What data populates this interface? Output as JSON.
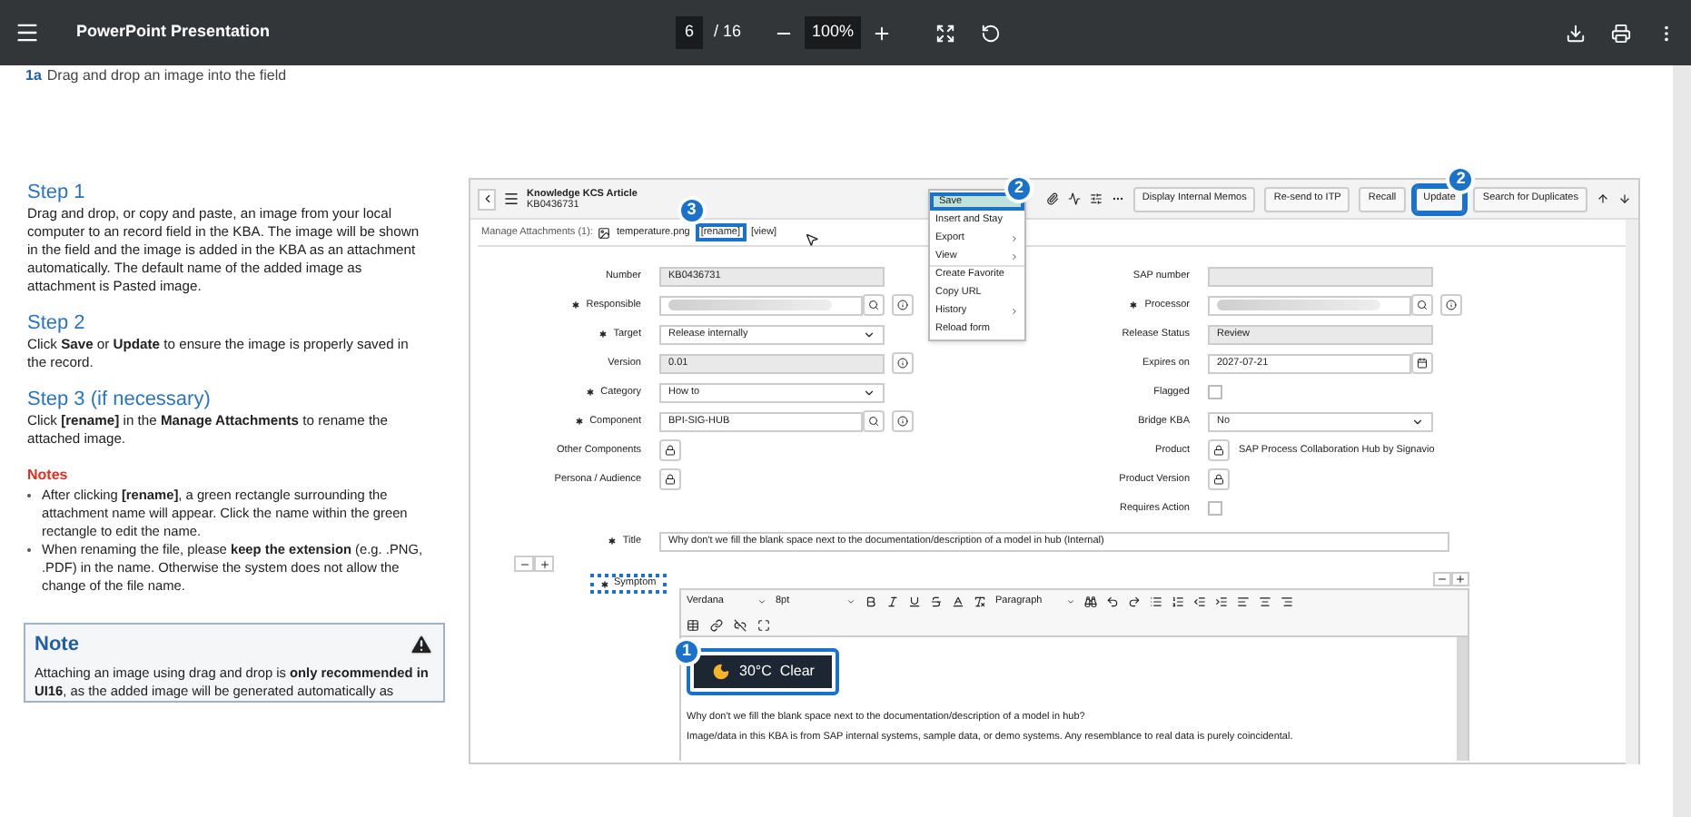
{
  "viewer": {
    "title": "PowerPoint Presentation",
    "page": "6",
    "page_count": "/ 16",
    "zoom": "100%"
  },
  "heading": {
    "number": "1a",
    "text": "Drag and drop an image into the field"
  },
  "steps": [
    {
      "title": "Step 1",
      "text": "Drag and drop, or copy and paste, an image from your local computer to an record field in the KBA. The image will be shown in the field and the image is added in the KBA as an attachment automatically. The default name of the added image as attachment is Pasted image."
    },
    {
      "title": "Step 2",
      "text": "Click **Save** or **Update** to ensure the image is properly saved in the record."
    },
    {
      "title": "Step 3 (if necessary)",
      "text": "Click **[rename]** in the **Manage Attachments** to rename the attached image."
    }
  ],
  "notes": {
    "title": "Notes",
    "items": [
      "After clicking **[rename]**, a green rectangle surrounding the attachment name will appear. Click the name within the green rectangle to edit the name.",
      "When renaming the file, please **keep the extension** (e.g. .PNG, .PDF) in the name. Otherwise the system does not allow the change of the file name."
    ]
  },
  "note_box": {
    "title": "Note",
    "text": "Attaching an image using drag and drop is **only recommended in UI16**, as the added image will be generated automatically as"
  },
  "record": {
    "title": "Knowledge KCS Article",
    "number": "KB0436731",
    "buttons": [
      {
        "label": "Display Internal Memos",
        "highlighted": false
      },
      {
        "label": "Re-send to ITP",
        "highlighted": false
      },
      {
        "label": "Recall",
        "highlighted": false
      },
      {
        "label": "Update",
        "highlighted": true,
        "callout": "2"
      },
      {
        "label": "Search for Duplicates",
        "highlighted": false
      }
    ],
    "menu": {
      "callout": "2",
      "items": [
        {
          "label": "Save",
          "submenu": false,
          "highlighted": true
        },
        {
          "label": "Insert and Stay",
          "submenu": false,
          "highlighted": false
        },
        {
          "label": "Export",
          "submenu": true,
          "highlighted": false
        },
        {
          "label": "View",
          "submenu": true,
          "highlighted": false
        },
        {
          "label": "Create Favorite",
          "submenu": false,
          "highlighted": false
        },
        {
          "label": "Copy URL",
          "submenu": false,
          "highlighted": false
        },
        {
          "label": "History",
          "submenu": true,
          "highlighted": false
        },
        {
          "label": "Reload form",
          "submenu": false,
          "highlighted": false
        }
      ]
    },
    "attachments": {
      "label": "Manage Attachments (1):",
      "file": "temperature.png",
      "rename": "[rename]",
      "rename_callout": "3",
      "view": "[view]"
    },
    "left_fields": [
      {
        "label": "Number",
        "required": false,
        "kind": "readonly",
        "value": "KB0436731",
        "info": false
      },
      {
        "label": "Responsible",
        "required": true,
        "kind": "lookup",
        "redacted": true,
        "info": true
      },
      {
        "label": "Target",
        "required": true,
        "kind": "select",
        "value": "Release internally",
        "info": false
      },
      {
        "label": "Version",
        "required": false,
        "kind": "readonly",
        "value": "0.01",
        "info": true
      },
      {
        "label": "Category",
        "required": true,
        "kind": "select",
        "value": "How to",
        "info": false
      },
      {
        "label": "Component",
        "required": true,
        "kind": "lookup",
        "value": "BPI-SIG-HUB",
        "info": true
      },
      {
        "label": "Other Components",
        "required": false,
        "kind": "lock",
        "info": false
      },
      {
        "label": "Persona / Audience",
        "required": false,
        "kind": "lock",
        "info": false
      }
    ],
    "right_fields": [
      {
        "label": "SAP number",
        "required": false,
        "kind": "readonly",
        "info": false
      },
      {
        "label": "Processor",
        "required": true,
        "kind": "lookup",
        "redacted": true,
        "info": true
      },
      {
        "label": "Release Status",
        "required": false,
        "kind": "readonly",
        "value": "Review",
        "info": false
      },
      {
        "label": "Expires on",
        "required": false,
        "kind": "date",
        "value": "2027-07-21",
        "info": false
      },
      {
        "label": "Flagged",
        "required": false,
        "kind": "checkbox",
        "checked": false,
        "info": false
      },
      {
        "label": "Bridge KBA",
        "required": false,
        "kind": "select",
        "value": "No",
        "info": false
      },
      {
        "label": "Product",
        "required": false,
        "kind": "lock",
        "value": "SAP Process Collaboration Hub by Signavio",
        "info": false
      },
      {
        "label": "Product Version",
        "required": false,
        "kind": "lock",
        "info": false
      },
      {
        "label": "Requires Action",
        "required": false,
        "kind": "checkbox",
        "checked": false,
        "info": false
      }
    ],
    "title_field": {
      "label": "Title",
      "required": true,
      "value": "Why don't we fill the blank space next to the documentation/description of a model in hub (Internal)"
    },
    "symptom": {
      "label": "Symptom",
      "required": true,
      "highlighted": true
    },
    "editor": {
      "font": "Verdana",
      "size": "8pt",
      "block": "Paragraph",
      "widget": {
        "text": "30°C  Clear",
        "callout": "1"
      },
      "lines": [
        "Why don't we fill the blank space next to the documentation/description of a model in hub?",
        "Image/data in this KBA is from SAP internal systems, sample data, or demo systems. Any resemblance to real data is purely coincidental."
      ]
    }
  }
}
